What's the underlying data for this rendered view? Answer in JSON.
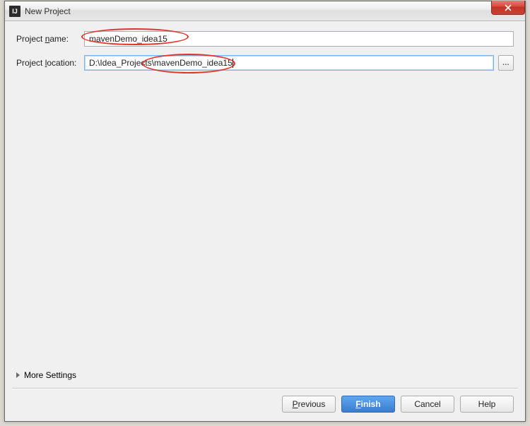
{
  "window": {
    "title": "New Project"
  },
  "fields": {
    "name_label_pre": "Project ",
    "name_label_mn": "n",
    "name_label_post": "ame:",
    "name_value": "mavenDemo_idea15",
    "location_label_pre": "Project ",
    "location_label_mn": "l",
    "location_label_post": "ocation:",
    "location_value": "D:\\Idea_Projects\\mavenDemo_idea15",
    "browse_label": "..."
  },
  "more_settings_label": "More Settings",
  "buttons": {
    "previous_mn": "P",
    "previous_rest": "revious",
    "finish_mn": "F",
    "finish_rest": "inish",
    "cancel": "Cancel",
    "help": "Help"
  }
}
